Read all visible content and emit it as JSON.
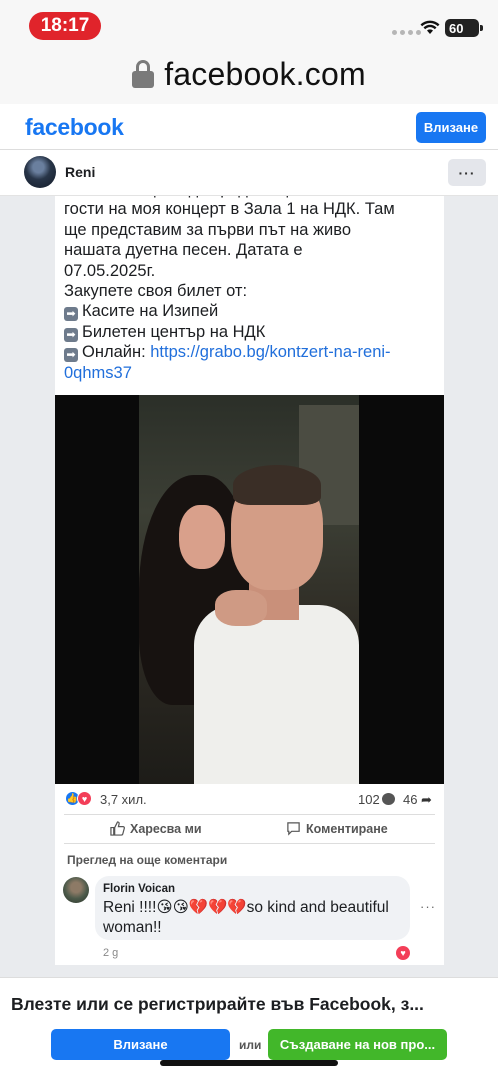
{
  "status_bar": {
    "time": "18:17",
    "battery": "60"
  },
  "browser": {
    "url": "facebook.com"
  },
  "header": {
    "logo": "facebook",
    "login_label": "Влизане"
  },
  "page": {
    "name": "Reni",
    "more_label": "···"
  },
  "post": {
    "text_lines": [
      "Tinй Янко ще бъде сред специалните",
      "гости на моя концерт в Зала 1 на НДК. Там",
      "ще представим за първи път на живо",
      "нашата дуетна песен. Датата е",
      "07.05.2025г.",
      "Закупете своя билет от:"
    ],
    "list_items": [
      "Касите на Изипей",
      "Билетен център на НДК"
    ],
    "online_prefix": "Онлайн: ",
    "online_link_1": "https://grabo.bg/kontzert-na-reni-",
    "online_link_2": "0qhms37",
    "reaction_count": "3,7 хил.",
    "comment_count": "102",
    "share_count": "46",
    "like_action": "Харесва ми",
    "comment_action": "Коментиране",
    "more_comments": "Преглед на още коментари"
  },
  "comment": {
    "author": "Florin Voican",
    "text": "Reni !!!!😘😘💔💔💔so kind and beautiful woman!!",
    "time": "2 g",
    "more_label": "···"
  },
  "bottom": {
    "prompt": "Влезте или се регистрирайте във Facebook, з...",
    "login_label": "Влизане",
    "or_label": "или",
    "create_label": "Създаване на нов про..."
  },
  "colors": {
    "brand": "#1877f2",
    "create_green": "#42b72a",
    "time_pill": "#e0242b"
  }
}
